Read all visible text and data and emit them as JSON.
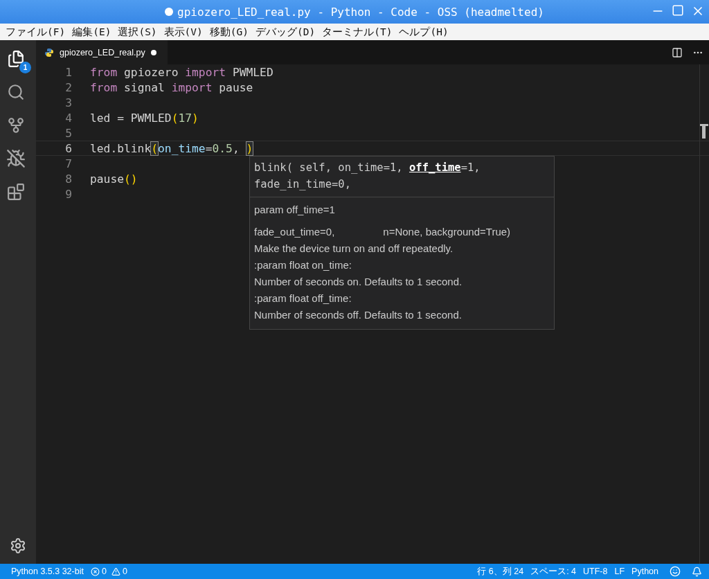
{
  "window": {
    "title": "gpiozero_LED_real.py - Python - Code - OSS (headmelted)",
    "modified": true
  },
  "menu": [
    "ファイル(F)",
    "編集(E)",
    "選択(S)",
    "表示(V)",
    "移動(G)",
    "デバッグ(D)",
    "ターミナル(T)",
    "ヘルプ(H)"
  ],
  "activity_bar": {
    "items": [
      {
        "kind": "files",
        "selected": true,
        "badge": "1"
      },
      {
        "kind": "search",
        "selected": false
      },
      {
        "kind": "scm",
        "selected": false
      },
      {
        "kind": "debug",
        "selected": false
      },
      {
        "kind": "extensions",
        "selected": false
      }
    ]
  },
  "tabs": [
    {
      "label": "gpiozero_LED_real.py",
      "selected": true,
      "modified": true
    }
  ],
  "editor": {
    "lines": [
      {
        "number": "1",
        "current": false,
        "tokens": [
          {
            "text": "from",
            "kind": "keyword"
          },
          {
            "text": " gpiozero ",
            "kind": "plain"
          },
          {
            "text": "import",
            "kind": "keyword"
          },
          {
            "text": " PWMLED",
            "kind": "plain"
          }
        ]
      },
      {
        "number": "2",
        "current": false,
        "tokens": [
          {
            "text": "from",
            "kind": "keyword"
          },
          {
            "text": " signal ",
            "kind": "plain"
          },
          {
            "text": "import",
            "kind": "keyword"
          },
          {
            "text": " pause",
            "kind": "plain"
          }
        ]
      },
      {
        "number": "3",
        "current": false
      },
      {
        "number": "4",
        "current": false,
        "tokens": [
          {
            "text": "led = PWMLED",
            "kind": "plain"
          },
          {
            "text": "(",
            "kind": "bracket"
          },
          {
            "text": "17",
            "kind": "number"
          },
          {
            "text": ")",
            "kind": "bracket"
          }
        ]
      },
      {
        "number": "5",
        "current": false
      },
      {
        "number": "6",
        "current": true,
        "tokens": [
          {
            "text": "led.blink",
            "kind": "plain"
          },
          {
            "text": "(",
            "kind": "matched"
          },
          {
            "text": "on_time",
            "kind": "param"
          },
          {
            "text": "=",
            "kind": "plain"
          },
          {
            "text": "0.5",
            "kind": "number"
          },
          {
            "text": ", ",
            "kind": "plain"
          },
          {
            "text": ")",
            "kind": "matched"
          }
        ]
      },
      {
        "number": "7",
        "current": false
      },
      {
        "number": "8",
        "current": false,
        "tokens": [
          {
            "text": "pause",
            "kind": "plain"
          },
          {
            "text": "()",
            "kind": "bracket"
          }
        ]
      },
      {
        "number": "9",
        "current": false
      }
    ]
  },
  "hover": {
    "signature": [
      {
        "text": "blink( self, on_time=1, ",
        "active": false
      },
      {
        "text": "off_time",
        "active": true
      },
      {
        "text": "=1,",
        "active": false
      }
    ],
    "signature_line2": "fade_in_time=0,",
    "param": "param off_time=1",
    "doc": [
      {
        "text": "fade_out_time=0,",
        "text2": "n=None, background=True)"
      },
      {
        "text": "Make the device turn on and off repeatedly."
      },
      {
        "text": ":param float on_time:"
      },
      {
        "text": "Number of seconds on. Defaults to 1 second."
      },
      {
        "text": ":param float off_time:"
      },
      {
        "text": "Number of seconds off. Defaults to 1 second."
      }
    ]
  },
  "status_bar": {
    "interpreter": "Python 3.5.3 32-bit",
    "errors": "0",
    "warnings": "0",
    "position": "行 6、列 24",
    "indent": "スペース: 4",
    "encoding": "UTF-8",
    "eol": "LF",
    "language": "Python"
  }
}
